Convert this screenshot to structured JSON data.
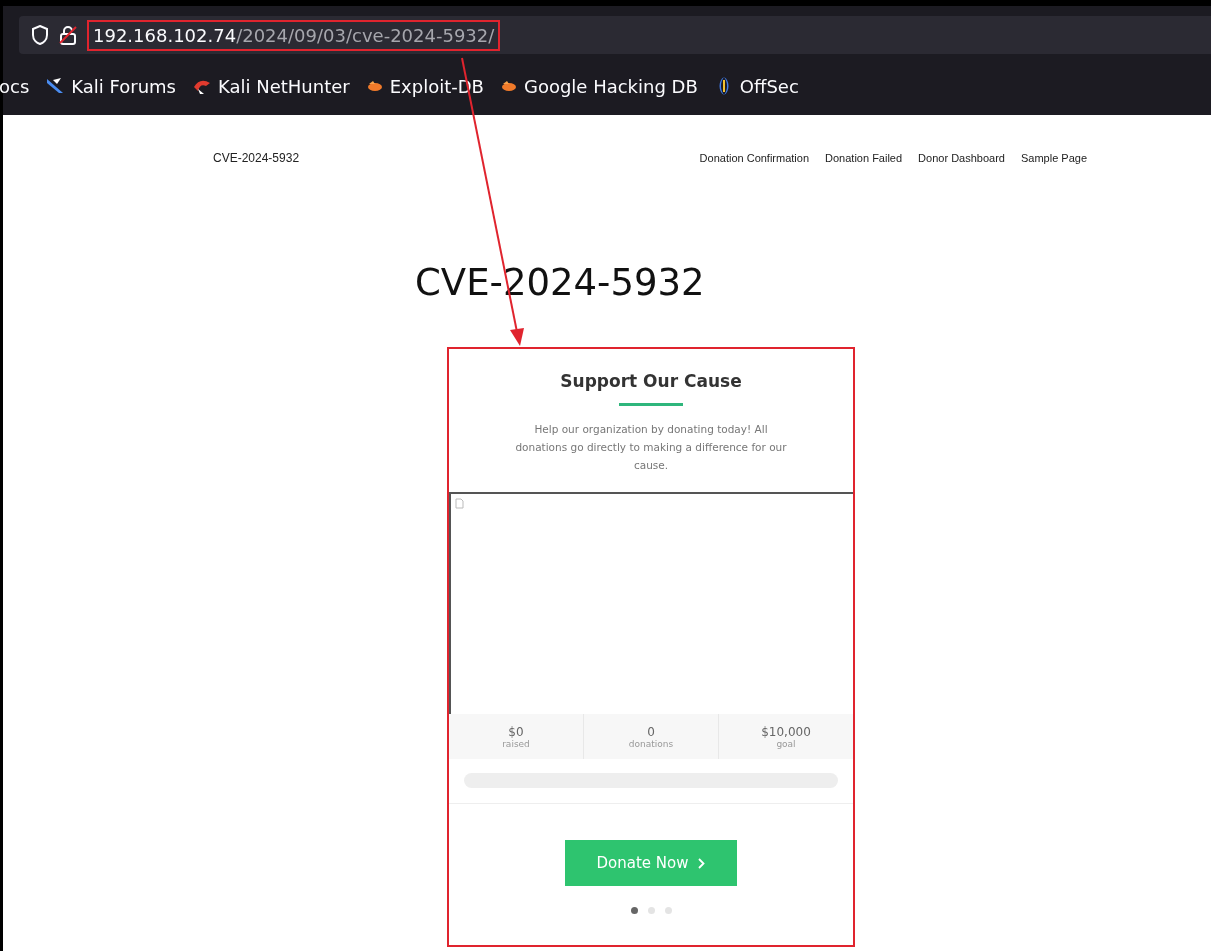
{
  "browser": {
    "url_host": "192.168.102.74",
    "url_path": "/2024/09/03/cve-2024-5932/",
    "bookmarks": [
      {
        "label": "ocs",
        "kind": "cut"
      },
      {
        "label": "Kali Forums",
        "kind": "kali-forums"
      },
      {
        "label": "Kali NetHunter",
        "kind": "nethunter"
      },
      {
        "label": "Exploit-DB",
        "kind": "exploit"
      },
      {
        "label": "Google Hacking DB",
        "kind": "exploit"
      },
      {
        "label": "OffSec",
        "kind": "offsec"
      }
    ]
  },
  "site": {
    "title": "CVE-2024-5932",
    "nav": [
      "Donation Confirmation",
      "Donation Failed",
      "Donor Dashboard",
      "Sample Page"
    ]
  },
  "heading": "CVE-2024-5932",
  "card": {
    "title": "Support Our Cause",
    "description": "Help our organization by donating today! All donations go directly to making a difference for our cause.",
    "stats": [
      {
        "value": "$0",
        "label": "raised"
      },
      {
        "value": "0",
        "label": "donations"
      },
      {
        "value": "$10,000",
        "label": "goal"
      }
    ],
    "progress": {
      "level": 0
    },
    "button": "Donate Now",
    "dots": [
      {
        "selected": true
      },
      {
        "selected": false
      },
      {
        "selected": false
      }
    ]
  }
}
